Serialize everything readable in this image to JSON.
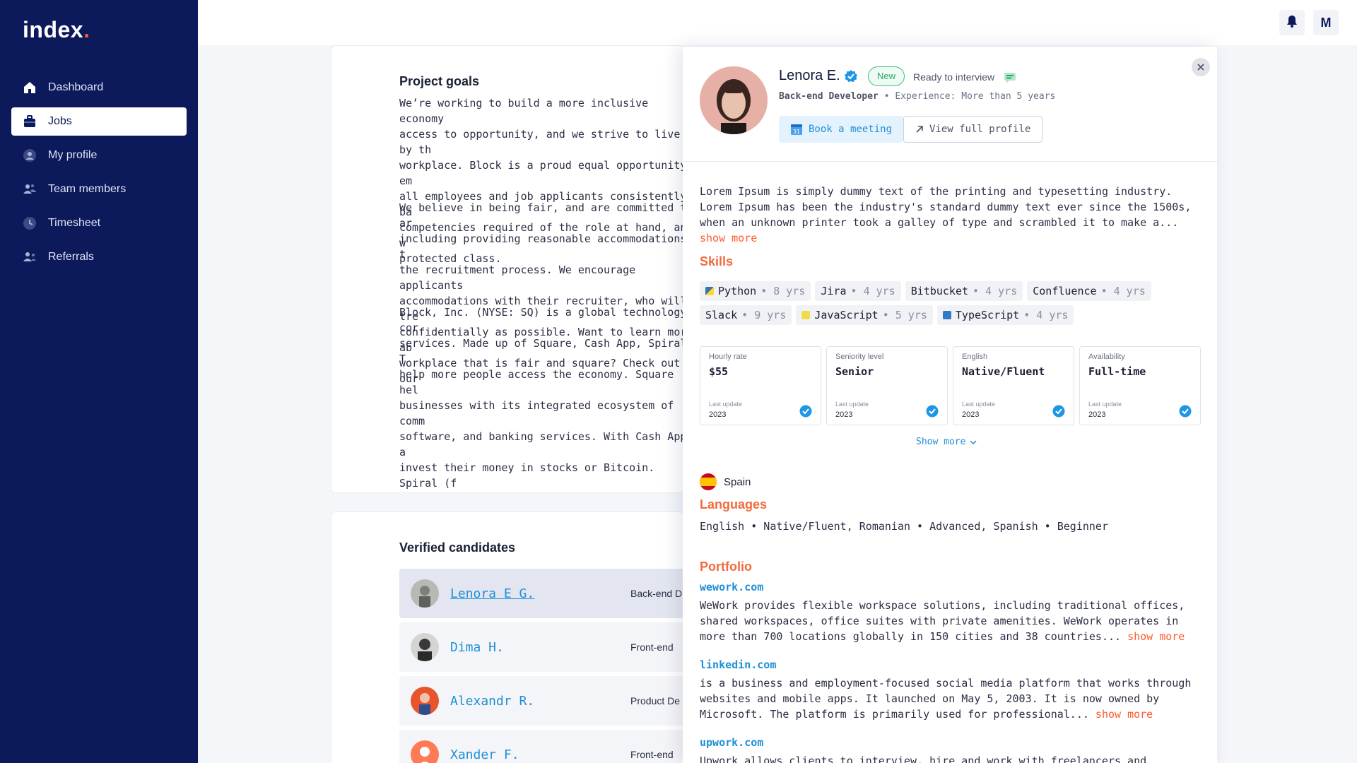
{
  "brand": {
    "name": "index",
    "dot": "."
  },
  "sidebar": {
    "items": [
      {
        "label": "Dashboard",
        "icon": "home-icon",
        "active": false
      },
      {
        "label": "Jobs",
        "icon": "briefcase-icon",
        "active": true
      },
      {
        "label": "My profile",
        "icon": "user-icon",
        "active": false
      },
      {
        "label": "Team members",
        "icon": "team-icon",
        "active": false
      },
      {
        "label": "Timesheet",
        "icon": "clock-icon",
        "active": false
      },
      {
        "label": "Referrals",
        "icon": "referrals-icon",
        "active": false
      }
    ]
  },
  "topbar": {
    "avatar_initial": "M",
    "notification_icon": "bell-icon"
  },
  "job": {
    "goals_title": "Project goals",
    "paragraphs": [
      "We’re working to build a more inclusive economy\naccess to opportunity, and we strive to live by th\nworkplace. Block is a proud equal opportunity em\nall employees and job applicants consistently, ba\ncompetencies required of the role at hand, and w\nprotected class.",
      "We believe in being fair, and are committed to ar\nincluding providing reasonable accommodations t\nthe recruitment process. We encourage applicants\naccommodations with their recruiter, who will tre\nconfidentially as possible. Want to learn more ab\nworkplace that is fair and square? Check out our",
      "Block, Inc. (NYSE: SQ) is a global technology cor\nservices. Made up of Square, Cash App, Spiral, T\nhelp more people access the economy. Square hel\nbusinesses with its integrated ecosystem of comm\nsoftware, and banking services. With Cash App, a\ninvest their money in stocks or Bitcoin. Spiral (f\nand funds free, open-source Bitcoin projects. Art\nsucceed as entrepreneurs and connect more deepl\nopen developer platform to make it easier to acce\ntechnologies without having to go through an ins"
    ]
  },
  "candidates": {
    "title": "Verified candidates",
    "rows": [
      {
        "name": "Lenora E G.",
        "role": "Back-end D"
      },
      {
        "name": "Dima H.",
        "role": "Front-end"
      },
      {
        "name": "Alexandr R.",
        "role": "Product De"
      },
      {
        "name": "Xander F.",
        "role": "Front-end"
      }
    ]
  },
  "profile": {
    "name": "Lenora E.",
    "badge": "New",
    "status": "Ready to interview",
    "role": "Back-end Developer",
    "experience": "• Experience: More than 5 years",
    "book_label": "Book a meeting",
    "book_day": "31",
    "view_label": "View full profile",
    "bio": "Lorem Ipsum is simply dummy text of the printing and typesetting industry. Lorem Ipsum has been the industry's standard dummy text ever since the 1500s, when an unknown printer took a galley of type and scrambled it to make a...",
    "show_more": "show more",
    "skills_title": "Skills",
    "skills": [
      {
        "name": "Python",
        "years": "• 8 yrs",
        "color": "#3776ab"
      },
      {
        "name": "Jira",
        "years": "• 4 yrs",
        "color": ""
      },
      {
        "name": "Bitbucket",
        "years": "• 4 yrs",
        "color": ""
      },
      {
        "name": "Confluence",
        "years": "• 4 yrs",
        "color": ""
      },
      {
        "name": "Slack",
        "years": "• 9 yrs",
        "color": ""
      },
      {
        "name": "JavaScript",
        "years": "• 5 yrs",
        "color": "#f0db4f"
      },
      {
        "name": "TypeScript",
        "years": "• 4 yrs",
        "color": "#3178c6"
      }
    ],
    "stats": [
      {
        "label": "Hourly rate",
        "value": "$55",
        "update_label": "Last update",
        "year": "2023"
      },
      {
        "label": "Seniority level",
        "value": "Senior",
        "update_label": "Last update",
        "year": "2023"
      },
      {
        "label": "English",
        "value": "Native/Fluent",
        "update_label": "Last update",
        "year": "2023"
      },
      {
        "label": "Availability",
        "value": "Full-time",
        "update_label": "Last update",
        "year": "2023"
      }
    ],
    "show_more_label": "Show more",
    "country": "Spain",
    "languages_title": "Languages",
    "languages": "English • Native/Fluent, Romanian • Advanced, Spanish • Beginner",
    "portfolio_title": "Portfolio",
    "portfolio": [
      {
        "site": "wework.com",
        "text": "WeWork provides flexible workspace solutions, including traditional offices, shared workspaces, office suites with private amenities. WeWork operates in more than 700 locations globally in 150 cities and 38 countries..."
      },
      {
        "site": "linkedin.com",
        "text": "is a business and employment-focused social media platform that works through websites and mobile apps. It launched on May 5, 2003. It is now owned by Microsoft. The platform is primarily used for professional..."
      },
      {
        "site": "upwork.com",
        "text": "Upwork allows clients to interview, hire and work with freelancers and freelance"
      }
    ]
  },
  "colors": {
    "sidebar": "#0c1a5b",
    "accent": "#ff5b2e",
    "link": "#1f8fd6",
    "success": "#27a86b"
  }
}
